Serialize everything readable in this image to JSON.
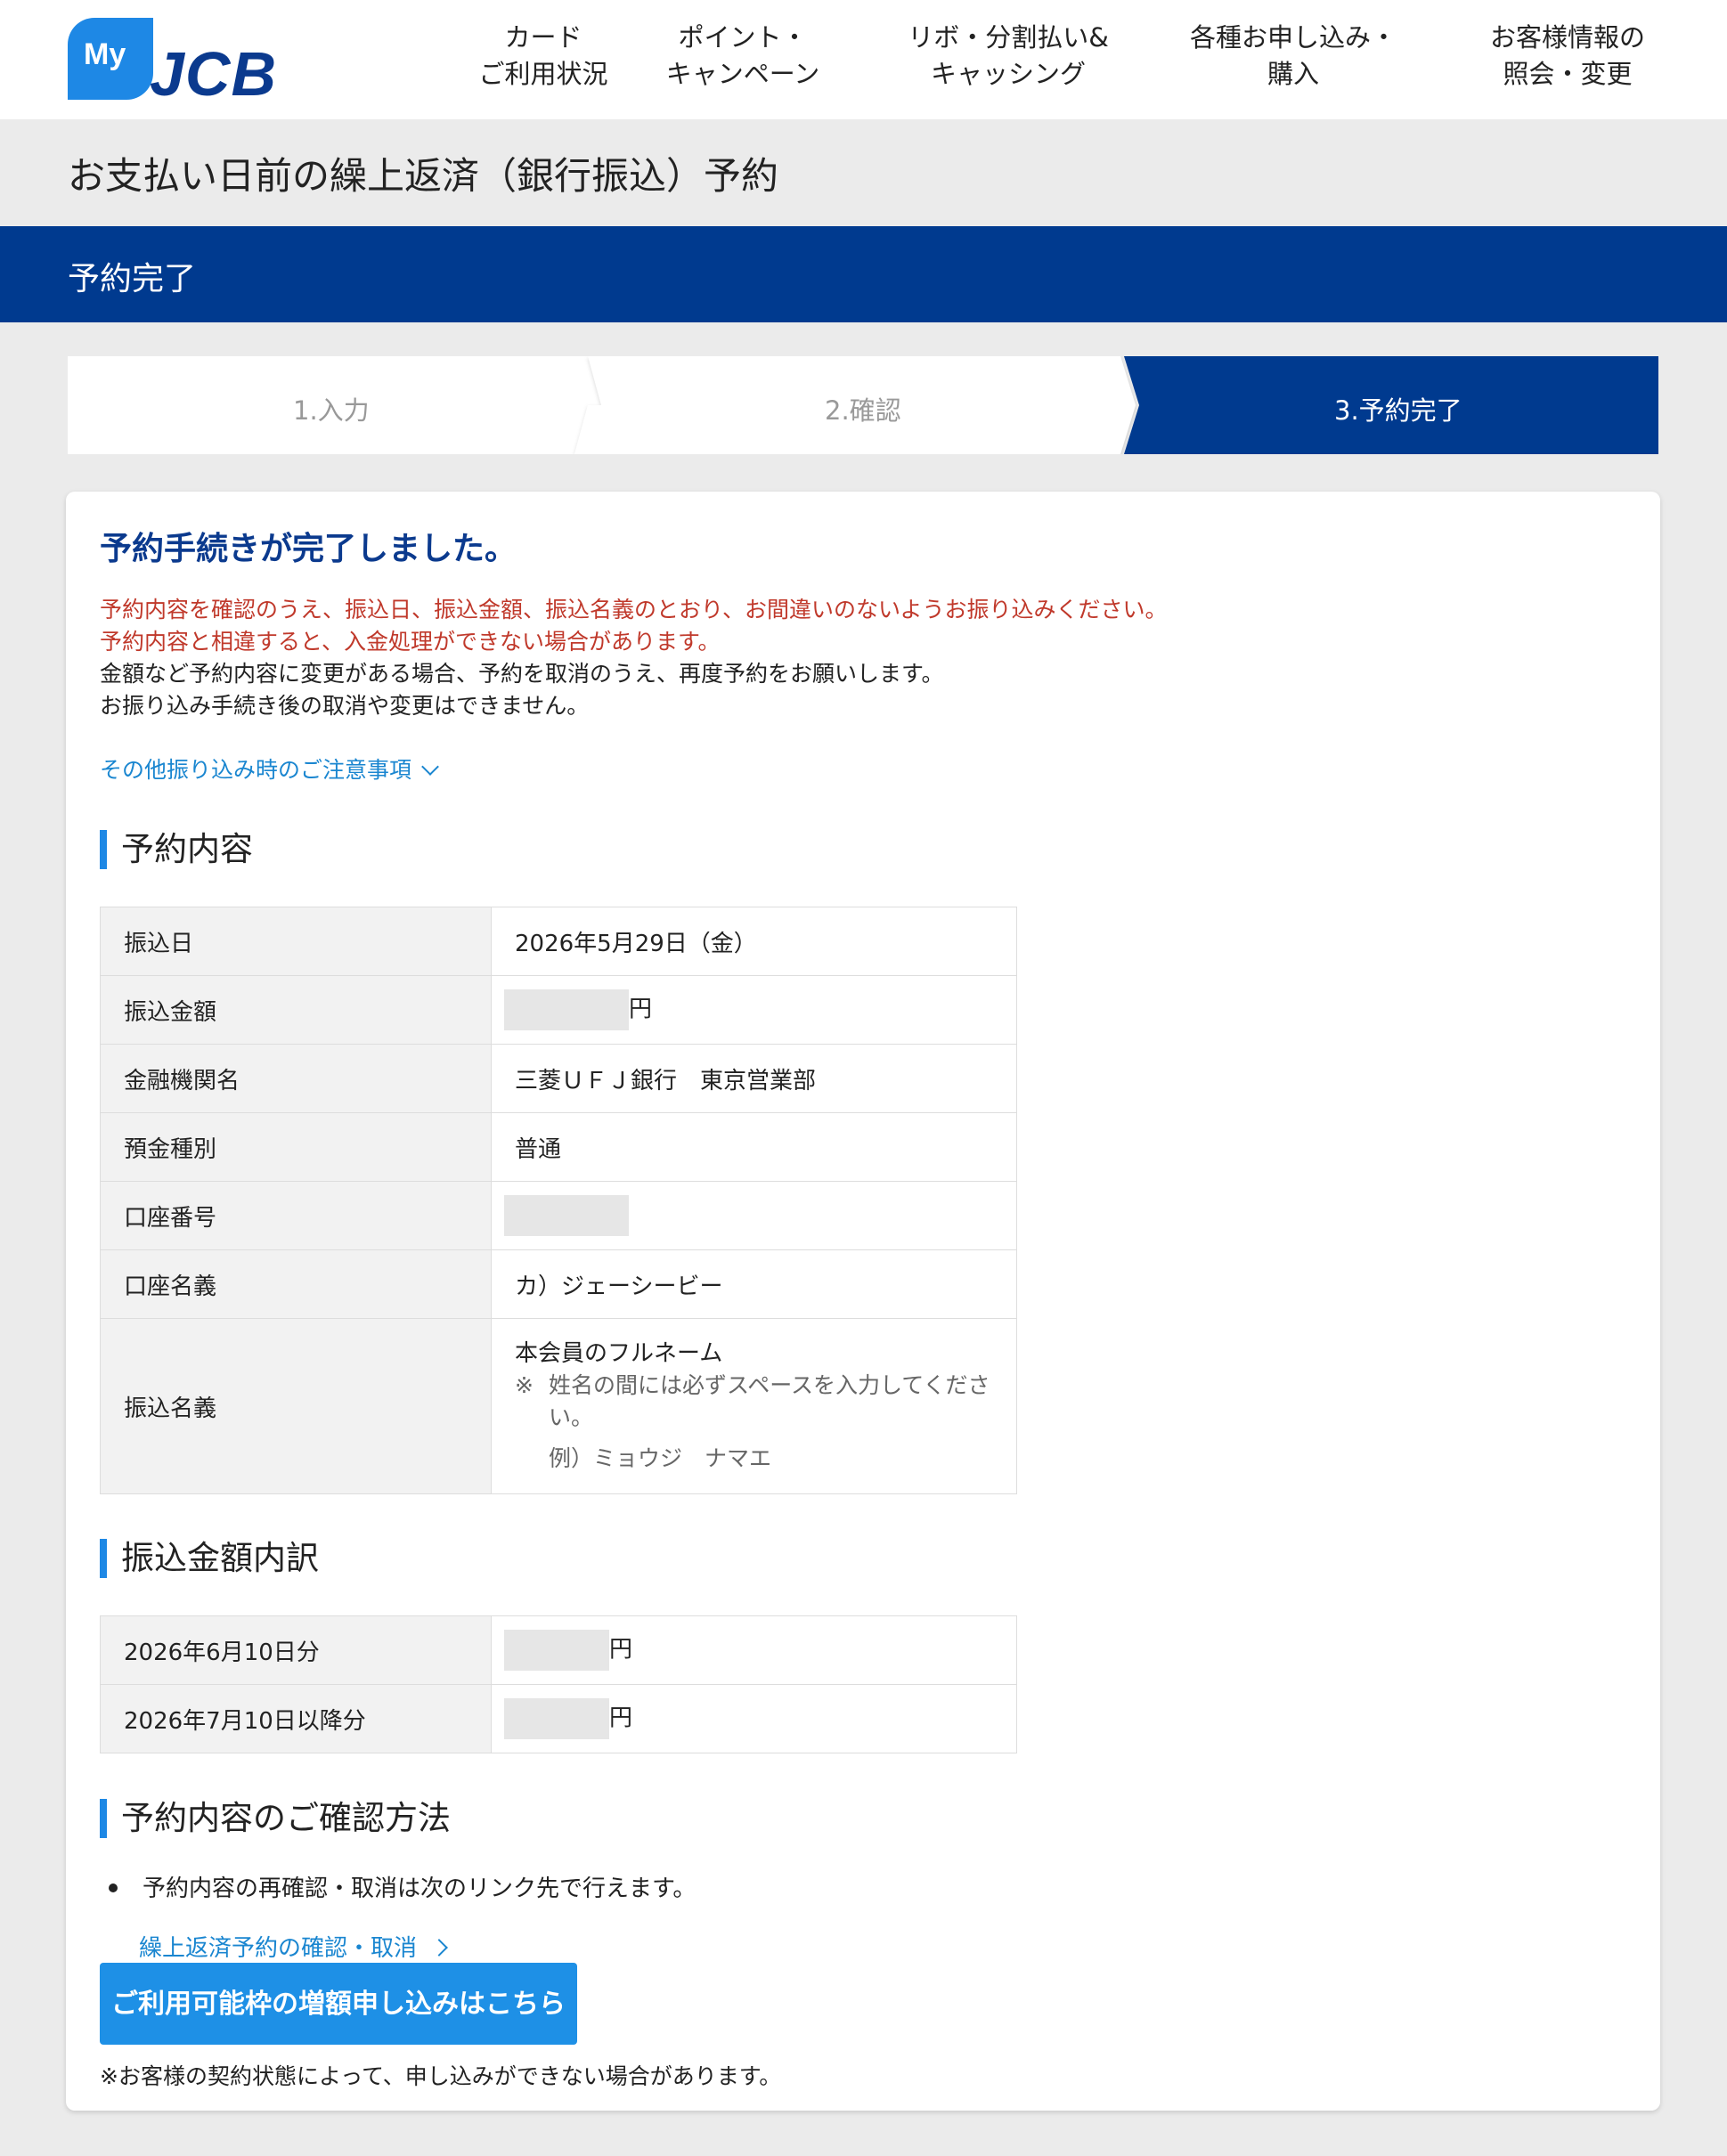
{
  "header": {
    "logo_prefix": "My",
    "logo_text": "JCB",
    "nav": [
      {
        "label": "カード\nご利用状況"
      },
      {
        "label": "ポイント・\nキャンペーン"
      },
      {
        "label": "リボ・分割払い&\nキャッシング"
      },
      {
        "label": "各種お申し込み・\n購入"
      },
      {
        "label": "お客様情報の\n照会・変更"
      }
    ]
  },
  "page": {
    "title": "お支払い日前の繰上返済（銀行振込）予約",
    "subtitle": "予約完了"
  },
  "steps": [
    {
      "label": "1.入力",
      "active": false
    },
    {
      "label": "2.確認",
      "active": false
    },
    {
      "label": "3.予約完了",
      "active": true
    }
  ],
  "card": {
    "title": "予約手続きが完了しました。",
    "notice_red_1": "予約内容を確認のうえ、振込日、振込金額、振込名義のとおり、お間違いのないようお振り込みください。",
    "notice_red_2": "予約内容と相違すると、入金処理ができない場合があります。",
    "notice_1": "金額など予約内容に変更がある場合、予約を取消のうえ、再度予約をお願いします。",
    "notice_2": "お振り込み手続き後の取消や変更はできません。",
    "accordion_label": "その他振り込み時のご注意事項"
  },
  "reservation": {
    "heading": "予約内容",
    "rows": {
      "transfer_date": {
        "label": "振込日",
        "value": "2026年5月29日（金）"
      },
      "amount": {
        "label": "振込金額",
        "unit": "円"
      },
      "bank": {
        "label": "金融機関名",
        "value": "三菱ＵＦＪ銀行　東京営業部"
      },
      "deposit_type": {
        "label": "預金種別",
        "value": "普通"
      },
      "account_number": {
        "label": "口座番号"
      },
      "account_name": {
        "label": "口座名義",
        "value": "カ）ジェーシービー"
      },
      "transfer_name": {
        "label": "振込名義",
        "value": "本会員のフルネーム",
        "note_mark": "※",
        "note": "姓名の間には必ずスペースを入力してください。",
        "example": "例）ミョウジ　ナマエ"
      }
    }
  },
  "breakdown": {
    "heading": "振込金額内訳",
    "rows": [
      {
        "label": "2026年6月10日分",
        "unit": "円"
      },
      {
        "label": "2026年7月10日以降分",
        "unit": "円"
      }
    ]
  },
  "confirm": {
    "heading": "予約内容のご確認方法",
    "bullet": "予約内容の再確認・取消は次のリンク先で行えます。",
    "link": "繰上返済予約の確認・取消",
    "cta": "ご利用可能枠の増額申し込みはこちら",
    "cta_note": "※お客様の契約状態によって、申し込みができない場合があります。"
  },
  "colors": {
    "brand_navy": "#003a8f",
    "accent_blue": "#1e88e5",
    "link_blue": "#1a86d0",
    "warning_red": "#c0392b"
  }
}
